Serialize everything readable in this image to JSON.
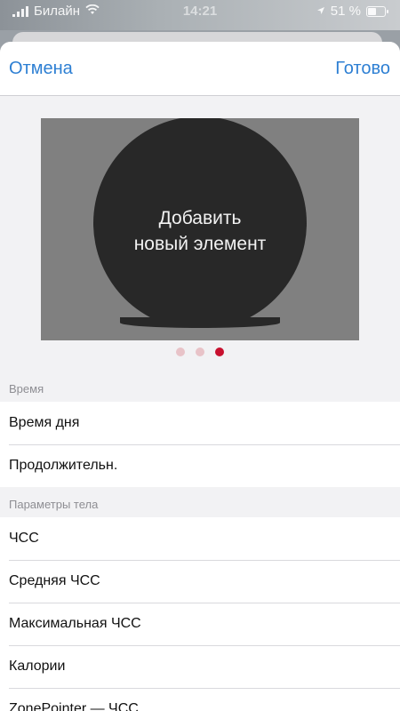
{
  "status_bar": {
    "carrier": "Билайн",
    "time": "14:21",
    "battery": "51 %"
  },
  "nav": {
    "cancel_label": "Отмена",
    "done_label": "Готово"
  },
  "preview": {
    "add_line1": "Добавить",
    "add_line2": "новый элемент",
    "pages_total": 3,
    "active_page": 3
  },
  "sections": [
    {
      "header": "Время",
      "rows": [
        "Время дня",
        "Продолжительн."
      ]
    },
    {
      "header": "Параметры тела",
      "rows": [
        "ЧСС",
        "Средняя ЧСС",
        "Максимальная ЧСС",
        "Калории",
        "ZonePointer — ЧСС"
      ]
    }
  ],
  "colors": {
    "accent": "#2d7fd3",
    "active_dot": "#c8102e",
    "inactive_dot": "#e8c3c8"
  }
}
